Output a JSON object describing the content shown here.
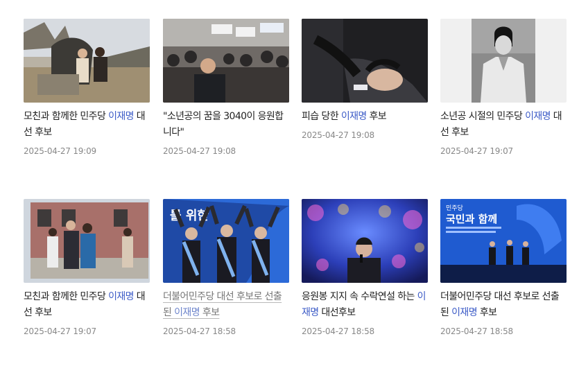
{
  "accent_color": "#3d5cc7",
  "articles": [
    {
      "parts": [
        "모친과 함께한 민주당 ",
        "이재명",
        " 대선 후보"
      ],
      "date": "2025-04-27 19:09",
      "image": "photo-mother-bench"
    },
    {
      "parts": [
        "\"소년공의 꿈을 3040이 응원합니다\""
      ],
      "date": "2025-04-27 19:08",
      "image": "photo-crowd-rally"
    },
    {
      "parts": [
        "피습 당한 ",
        "이재명",
        " 후보"
      ],
      "date": "2025-04-27 19:08",
      "image": "photo-attack"
    },
    {
      "parts": [
        "소년공 시절의 민주당 ",
        "이재명",
        " 대선 후보"
      ],
      "date": "2025-04-27 19:07",
      "image": "photo-youth-bw"
    },
    {
      "parts": [
        "모친과 함께한 민주당 ",
        "이재명",
        " 대선 후보"
      ],
      "date": "2025-04-27 19:07",
      "image": "photo-family-street"
    },
    {
      "parts": [
        "더불어민주당 대선 후보로 선출된 ",
        "이재명",
        " 후보"
      ],
      "date": "2025-04-27 18:58",
      "image": "photo-candidates-stage",
      "visited": true
    },
    {
      "parts": [
        "응원봉 지지 속 수락연설 하는 ",
        "이재명",
        " 대선후보"
      ],
      "date": "2025-04-27 18:58",
      "image": "photo-speech-lights"
    },
    {
      "parts": [
        "더불어민주당 대선 후보로 선출된 ",
        "이재명",
        " 후보"
      ],
      "date": "2025-04-27 18:58",
      "image": "photo-stage-wide"
    }
  ],
  "slogans": {
    "stage2_banner": "국민과 함께",
    "stage2_party": "민주당",
    "stage1_caption": "를 위한"
  }
}
